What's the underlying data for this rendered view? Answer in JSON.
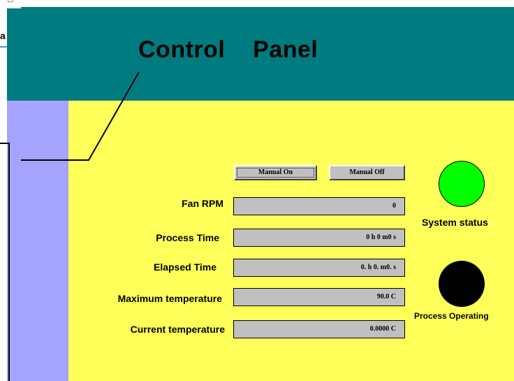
{
  "panel": {
    "title": "Control    Panel"
  },
  "corner": {
    "text": "a"
  },
  "buttons": {
    "manual_on": "Manual On",
    "manual_off": "Manual Off"
  },
  "fields": [
    {
      "label": "Fan RPM",
      "value": "0"
    },
    {
      "label": "Process Time",
      "value": "0 h 0 m0 s"
    },
    {
      "label": "Elapsed Time",
      "value": "0. h 0. m0. s"
    },
    {
      "label": "Maximum temperature",
      "value": "90.0   C"
    },
    {
      "label": "Current temperature",
      "value": "0.0000   C"
    }
  ],
  "indicators": {
    "system_status": {
      "label": "System status",
      "color": "#00ff00"
    },
    "process_operating": {
      "label": "Process Operating",
      "color": "#000000"
    }
  }
}
